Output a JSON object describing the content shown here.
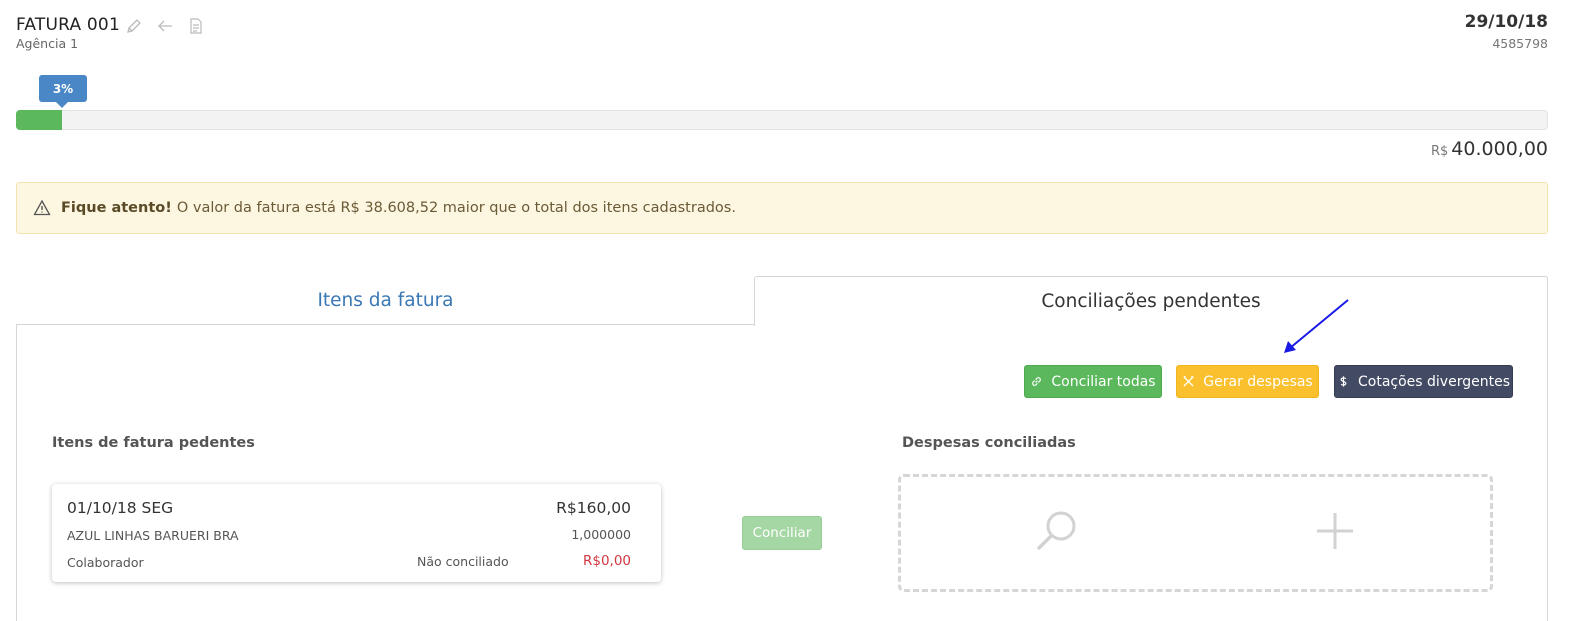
{
  "header": {
    "title": "FATURA 001",
    "subtitle": "Agência 1",
    "date": "29/10/18",
    "code": "4585798"
  },
  "progress": {
    "label": "3%",
    "value": 0.03,
    "currency": "R$",
    "total": "40.000,00"
  },
  "alert": {
    "strong": "Fique atento!",
    "message": "O valor da fatura está R$ 38.608,52 maior que o total dos itens cadastrados."
  },
  "tabs": [
    {
      "label": "Itens da fatura",
      "active": false
    },
    {
      "label": "Conciliações pendentes",
      "active": true
    }
  ],
  "actions": {
    "reconcile_all": "Conciliar todas",
    "generate_expenses": "Gerar despesas",
    "divergent_quotes": "Cotações divergentes"
  },
  "pending": {
    "heading": "Itens de fatura pedentes",
    "items": [
      {
        "date": "01/10/18 SEG",
        "amount": "R$160,00",
        "vendor": "AZUL LINHAS BARUERI BRA",
        "rate": "1,000000",
        "role": "Colaborador",
        "status": "Não conciliado",
        "reconciled_value": "R$0,00"
      }
    ],
    "reconcile_button": "Conciliar"
  },
  "reconciled": {
    "heading": "Despesas conciliadas"
  },
  "colors": {
    "primary": "#4a87c6",
    "success": "#5cb85c",
    "warning": "#fbc02d",
    "dark": "#434a64",
    "danger": "#d0383e",
    "annotation_arrow": "#1a1ae6"
  },
  "icons": [
    "pencil-icon",
    "arrow-left-icon",
    "document-icon",
    "warning-icon",
    "link-icon",
    "tools-icon",
    "dollar-icon",
    "search-icon",
    "plus-icon"
  ]
}
